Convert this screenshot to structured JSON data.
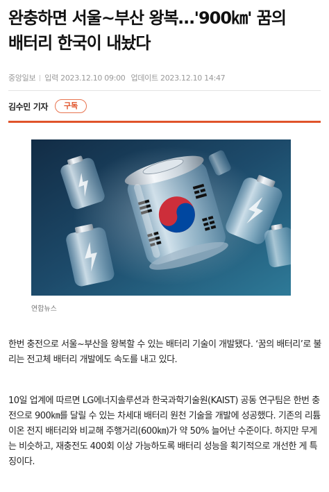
{
  "article": {
    "headline": "완충하면 서울~부산 왕복…'900㎞' 꿈의 배터리 한국이 내놨다",
    "source": "중앙일보",
    "published_label": "입력",
    "published_time": "2023.12.10 09:00",
    "updated_label": "업데이트",
    "updated_time": "2023.12.10 14:47",
    "author": "김수민 기자",
    "subscribe_label": "구독",
    "image_caption": "연합뉴스",
    "paragraphs": [
      "한번 충전으로 서울~부산을 왕복할 수 있는 배터리 기술이 개발됐다. ‘꿈의 배터리’로 불리는 전고체 배터리 개발에도 속도를 내고 있다.",
      "10일 업계에 따르면 LG에너지솔루션과 한국과학기술원(KAIST) 공동 연구팀은 한번 충전으로 900㎞를 달릴 수 있는 차세대 배터리 원천 기술을 개발에 성공했다. 기존의 리튬이온 전지 배터리와 비교해 주행거리(600㎞)가 약 50% 늘어난 수준이다. 하지만 무게는 비슷하고, 재충전도 400회 이상 가능하도록 배터리 성능을 획기적으로 개선한 게 특징이다."
    ]
  },
  "colors": {
    "accent": "#e0532a",
    "image_background": "#1d4b6b",
    "flag_red": "#cd2e3a",
    "flag_blue": "#0047a0"
  }
}
